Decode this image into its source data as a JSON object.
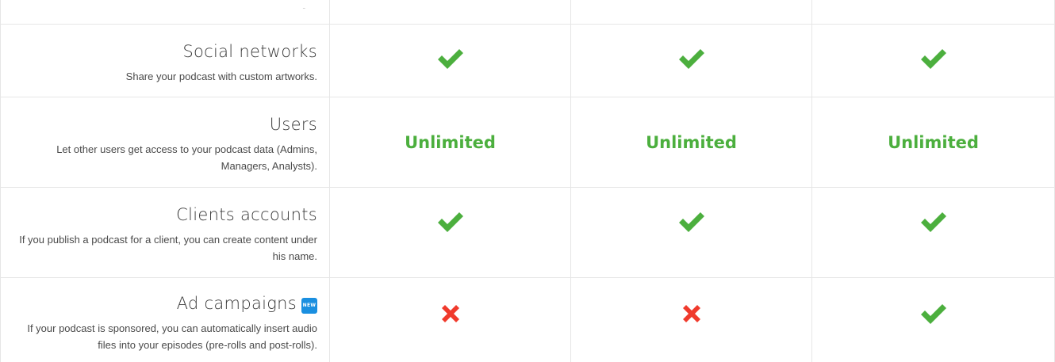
{
  "colors": {
    "check": "#4caf3e",
    "cross": "#f03a2c",
    "new_badge": "#1a8fe0",
    "border": "#e6e6e6"
  },
  "top_row": {
    "partial_mark": "ˍ"
  },
  "features": [
    {
      "title": "Social networks",
      "description": "Share your podcast with custom artworks.",
      "values": [
        "check",
        "check",
        "check"
      ]
    },
    {
      "title": "Users",
      "description": "Let other users get access to your podcast data (Admins, Managers, Analysts).",
      "values": [
        "Unlimited",
        "Unlimited",
        "Unlimited"
      ]
    },
    {
      "title": "Clients accounts",
      "description": "If you publish a podcast for a client, you can create content under his name.",
      "values": [
        "check",
        "check",
        "check"
      ]
    },
    {
      "title": "Ad campaigns",
      "badge": "NEW",
      "description": "If your podcast is sponsored, you can automatically insert audio files into your episodes (pre-rolls and post-rolls).",
      "values": [
        "cross",
        "cross",
        "check"
      ]
    }
  ],
  "icons": {
    "check": "check-icon",
    "cross": "cross-icon",
    "badge": "new-badge-icon"
  }
}
